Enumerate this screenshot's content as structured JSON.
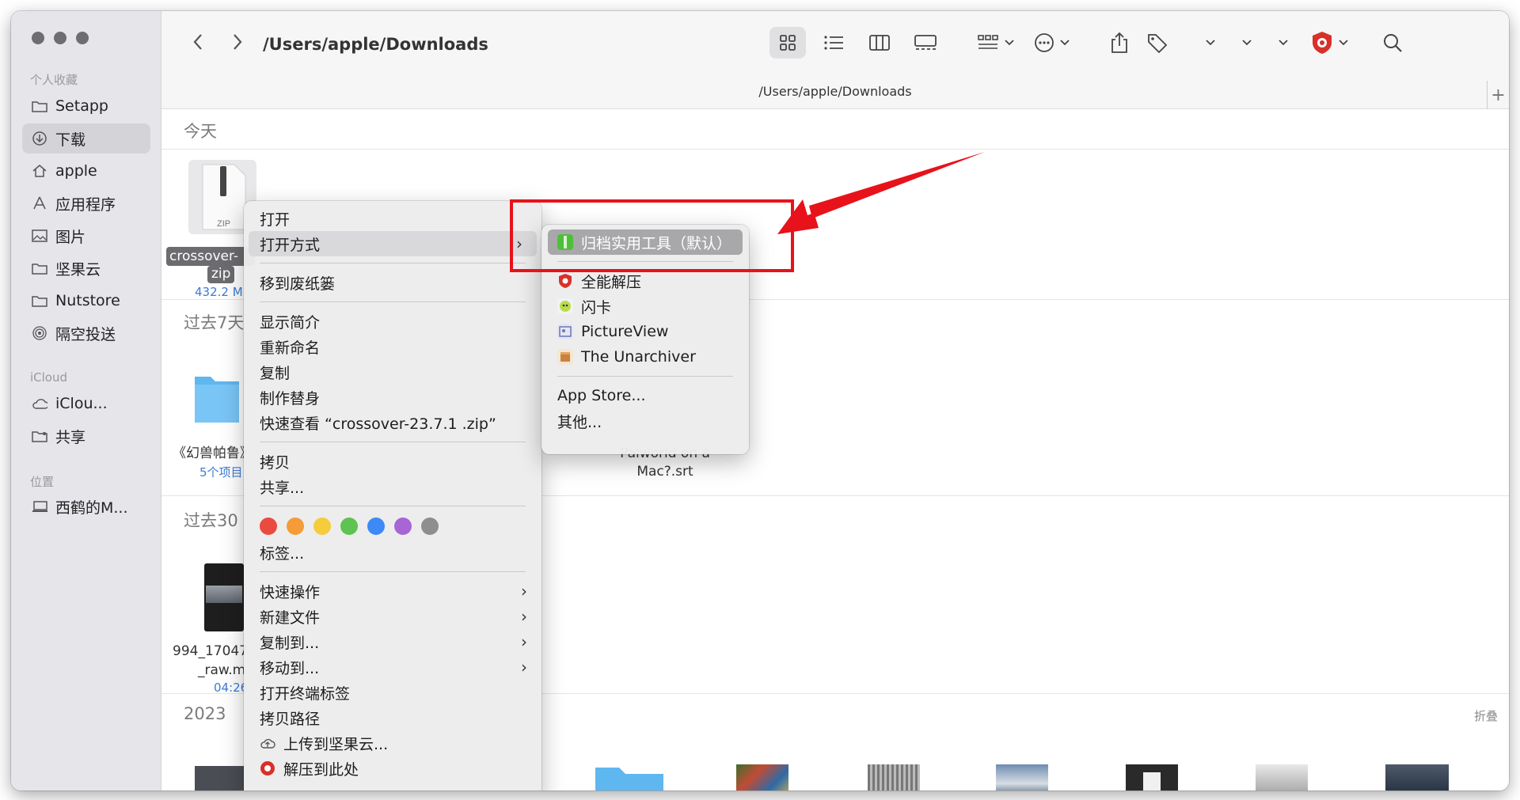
{
  "sidebar": {
    "section_favorites": "个人收藏",
    "favorites": [
      {
        "label": "Setapp",
        "icon": "folder-icon"
      },
      {
        "label": "下载",
        "icon": "download-icon"
      },
      {
        "label": "apple",
        "icon": "home-icon"
      },
      {
        "label": "应用程序",
        "icon": "applications-icon"
      },
      {
        "label": "图片",
        "icon": "photo-icon"
      },
      {
        "label": "坚果云",
        "icon": "folder-icon"
      },
      {
        "label": "Nutstore",
        "icon": "folder-icon"
      },
      {
        "label": "隔空投送",
        "icon": "airdrop-icon"
      }
    ],
    "section_icloud": "iCloud",
    "icloud": [
      {
        "label": "iClou...",
        "icon": "cloud-icon"
      },
      {
        "label": "共享",
        "icon": "shared-folder-icon"
      }
    ],
    "section_locations": "位置",
    "locations": [
      {
        "label": "西鹤的M...",
        "icon": "laptop-icon"
      }
    ]
  },
  "toolbar": {
    "path_title": "/Users/apple/Downloads"
  },
  "pathbar": {
    "path": "/Users/apple/Downloads"
  },
  "content": {
    "sections": [
      "今天",
      "过去7天",
      "过去30",
      "2023"
    ],
    "fold_label": "折叠",
    "files": {
      "zip_name_line1": "crossover-",
      "zip_name_line2": "zip",
      "zip_size": "432.2 M",
      "zip_icon_text": "ZIP",
      "folder_name": "《幻兽帕鲁》",
      "folder_count": "5个项目",
      "srt_line1": "Palworld on a",
      "srt_line2": "Mac?.srt",
      "video_line1": "994_17047",
      "video_line2": "_raw.m",
      "video_duration": "04:26"
    }
  },
  "context_menu": {
    "open": "打开",
    "open_with": "打开方式",
    "trash": "移到废纸篓",
    "info": "显示简介",
    "rename": "重新命名",
    "duplicate": "复制",
    "alias": "制作替身",
    "quicklook": "快速查看 “crossover-23.7.1 .zip”",
    "copy": "拷贝",
    "share": "共享...",
    "tags": "标签...",
    "quick_actions": "快速操作",
    "new_file": "新建文件",
    "copy_to": "复制到...",
    "move_to": "移动到...",
    "open_terminal_tab": "打开终端标签",
    "copy_path": "拷贝路径",
    "upload_nutstore": "上传到坚果云...",
    "extract_here": "解压到此处",
    "tag_colors": [
      "#ea4b40",
      "#f39c38",
      "#f4cc3c",
      "#5ec350",
      "#3d8af7",
      "#a765d6",
      "#8e8e90"
    ]
  },
  "submenu": {
    "default_app": "归档实用工具（默认）",
    "apps": [
      "全能解压",
      "闪卡",
      "PictureView",
      "The Unarchiver"
    ],
    "app_store": "App Store...",
    "other": "其他..."
  },
  "colors": {
    "annotation_red": "#e8121a",
    "sidebar_bg": "#e6e5ea",
    "link_blue": "#3b7bd6"
  }
}
